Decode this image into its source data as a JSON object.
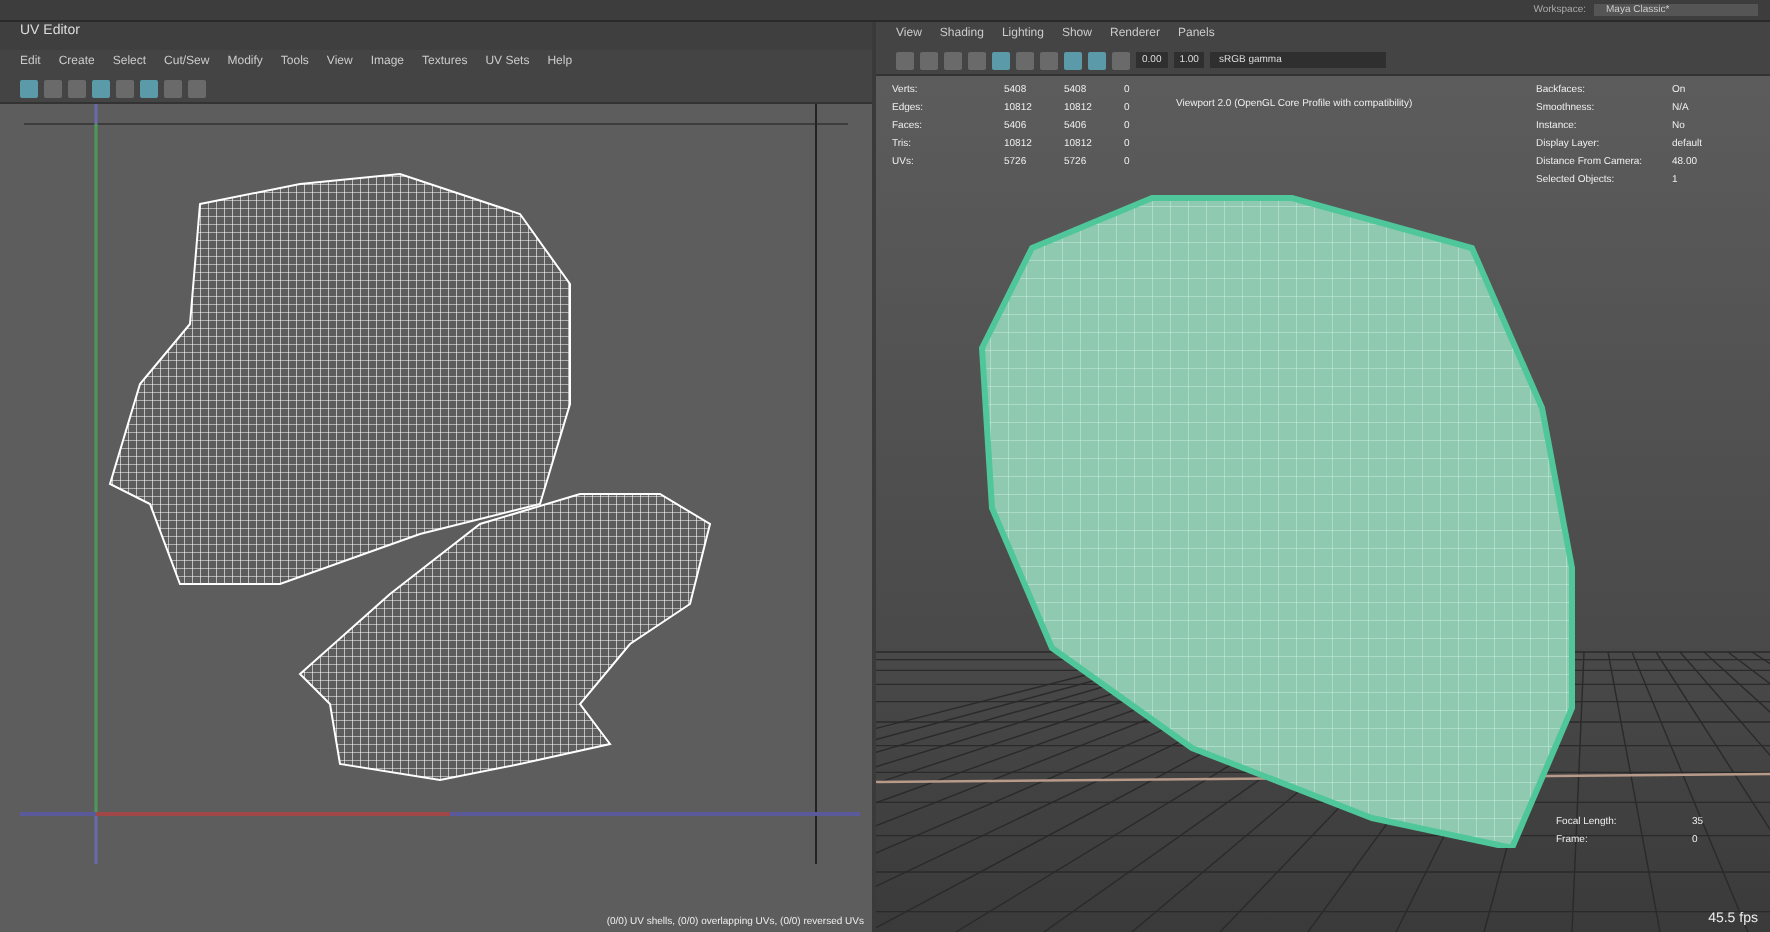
{
  "uv_editor": {
    "title": "UV Editor",
    "menu": [
      "Edit",
      "Create",
      "Select",
      "Cut/Sew",
      "Modify",
      "Tools",
      "View",
      "Image",
      "Textures",
      "UV Sets",
      "Help"
    ],
    "status": "(0/0) UV shells, (0/0) overlapping UVs, (0/0) reversed UVs"
  },
  "viewport": {
    "workspace_label": "Workspace:",
    "workspace": "Maya Classic*",
    "menu": [
      "View",
      "Shading",
      "Lighting",
      "Show",
      "Renderer",
      "Panels"
    ],
    "exposure": "0.00",
    "gamma": "1.00",
    "color_space": "sRGB gamma",
    "stats": [
      {
        "label": "Verts:",
        "values": [
          "5408",
          "5408",
          "0"
        ]
      },
      {
        "label": "Edges:",
        "values": [
          "10812",
          "10812",
          "0"
        ]
      },
      {
        "label": "Faces:",
        "values": [
          "5406",
          "5406",
          "0"
        ]
      },
      {
        "label": "Tris:",
        "values": [
          "10812",
          "10812",
          "0"
        ]
      },
      {
        "label": "UVs:",
        "values": [
          "5726",
          "5726",
          "0"
        ]
      }
    ],
    "renderer_info": "Viewport 2.0 (OpenGL Core Profile with compatibility)",
    "hud_right": [
      {
        "label": "Backfaces:",
        "value": "On"
      },
      {
        "label": "Smoothness:",
        "value": "N/A"
      },
      {
        "label": "Instance:",
        "value": "No"
      },
      {
        "label": "Display Layer:",
        "value": "default"
      },
      {
        "label": "Distance From Camera:",
        "value": "48.00"
      },
      {
        "label": "Selected Objects:",
        "value": "1"
      }
    ],
    "hud_bottom": [
      {
        "label": "Focal Length:",
        "value": "35"
      },
      {
        "label": "Frame:",
        "value": "0"
      }
    ],
    "fps": "45.5 fps"
  }
}
